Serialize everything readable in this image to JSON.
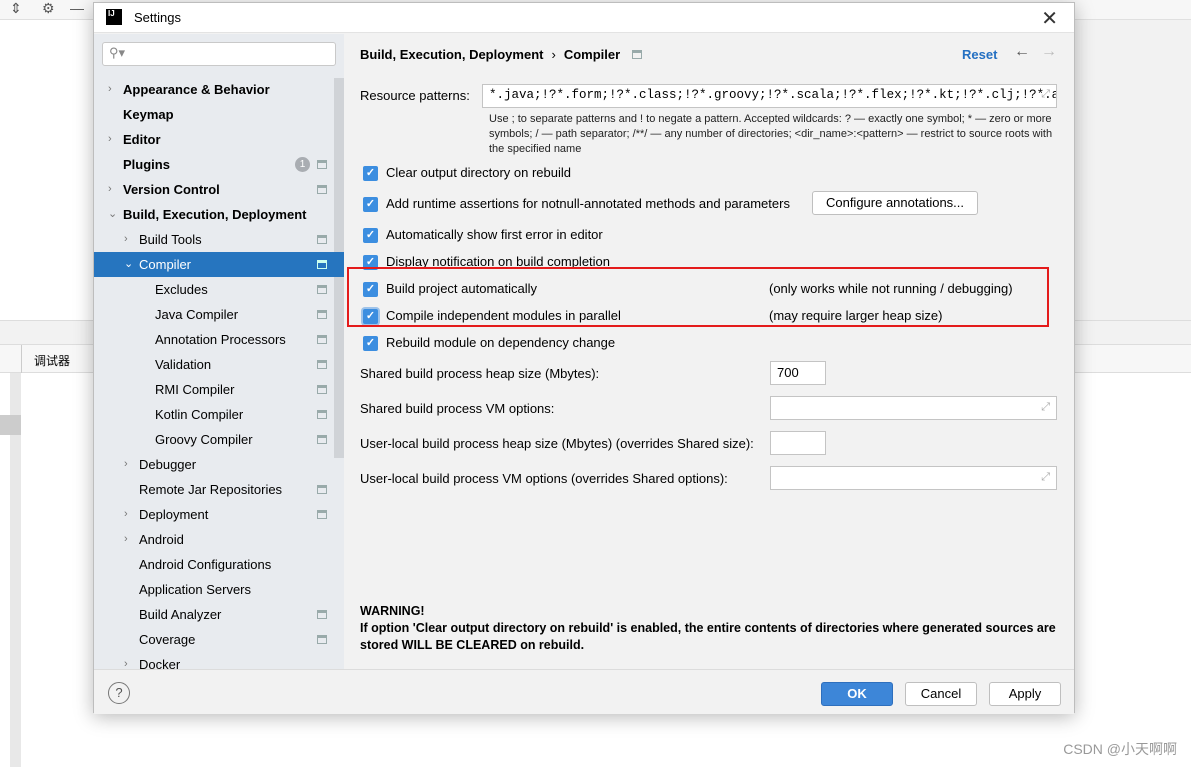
{
  "background": {
    "tab_label": "调试器",
    "watermark": "CSDN @小天啊啊"
  },
  "dialog": {
    "title": "Settings",
    "logo": "IJ",
    "close": "✕"
  },
  "sidebar": {
    "search_placeholder": "",
    "items": [
      {
        "label": "Appearance & Behavior",
        "level": 0,
        "arrow": "›",
        "bold": true
      },
      {
        "label": "Keymap",
        "level": 0,
        "arrow": "",
        "bold": true
      },
      {
        "label": "Editor",
        "level": 0,
        "arrow": "›",
        "bold": true
      },
      {
        "label": "Plugins",
        "level": 0,
        "arrow": "",
        "bold": true,
        "badge": "1",
        "cfg": true
      },
      {
        "label": "Version Control",
        "level": 0,
        "arrow": "›",
        "bold": true,
        "cfg": true
      },
      {
        "label": "Build, Execution, Deployment",
        "level": 0,
        "arrow": "⌄",
        "bold": true
      },
      {
        "label": "Build Tools",
        "level": 1,
        "arrow": "›",
        "cfg": true
      },
      {
        "label": "Compiler",
        "level": 1,
        "arrow": "⌄",
        "cfg": true,
        "selected": true
      },
      {
        "label": "Excludes",
        "level": 2,
        "arrow": "",
        "cfg": true
      },
      {
        "label": "Java Compiler",
        "level": 2,
        "arrow": "",
        "cfg": true
      },
      {
        "label": "Annotation Processors",
        "level": 2,
        "arrow": "",
        "cfg": true
      },
      {
        "label": "Validation",
        "level": 2,
        "arrow": "",
        "cfg": true
      },
      {
        "label": "RMI Compiler",
        "level": 2,
        "arrow": "",
        "cfg": true
      },
      {
        "label": "Kotlin Compiler",
        "level": 2,
        "arrow": "",
        "cfg": true
      },
      {
        "label": "Groovy Compiler",
        "level": 2,
        "arrow": "",
        "cfg": true
      },
      {
        "label": "Debugger",
        "level": 1,
        "arrow": "›"
      },
      {
        "label": "Remote Jar Repositories",
        "level": 1,
        "arrow": "",
        "cfg": true
      },
      {
        "label": "Deployment",
        "level": 1,
        "arrow": "›",
        "cfg": true
      },
      {
        "label": "Android",
        "level": 1,
        "arrow": "›"
      },
      {
        "label": "Android Configurations",
        "level": 1,
        "arrow": ""
      },
      {
        "label": "Application Servers",
        "level": 1,
        "arrow": ""
      },
      {
        "label": "Build Analyzer",
        "level": 1,
        "arrow": "",
        "cfg": true
      },
      {
        "label": "Coverage",
        "level": 1,
        "arrow": "",
        "cfg": true
      },
      {
        "label": "Docker",
        "level": 1,
        "arrow": "›"
      }
    ]
  },
  "main": {
    "breadcrumb": [
      "Build, Execution, Deployment",
      "Compiler"
    ],
    "breadcrumb_sep": "›",
    "reset": "Reset",
    "back": "←",
    "forward": "→",
    "resource_label": "Resource patterns:",
    "resource_value": "*.java;!?*.form;!?*.class;!?*.groovy;!?*.scala;!?*.flex;!?*.kt;!?*.clj;!?*.aj",
    "help_text": "Use ; to separate patterns and ! to negate a pattern. Accepted wildcards: ? — exactly one symbol; * — zero or more symbols; / — path separator; /**/ — any number of directories; <dir_name>:<pattern> — restrict to source roots with the specified name",
    "checkboxes": [
      {
        "label": "Clear output directory on rebuild",
        "checked": true
      },
      {
        "label": "Add runtime assertions for notnull-annotated methods and parameters",
        "checked": true
      },
      {
        "label": "Automatically show first error in editor",
        "checked": true
      },
      {
        "label": "Display notification on build completion",
        "checked": true
      },
      {
        "label": "Build project automatically",
        "checked": true,
        "note": "(only works while not running / debugging)"
      },
      {
        "label": "Compile independent modules in parallel",
        "checked": true,
        "note": "(may require larger heap size)"
      },
      {
        "label": "Rebuild module on dependency change",
        "checked": true
      }
    ],
    "configure_annotations": "Configure annotations...",
    "fields": [
      {
        "label": "Shared build process heap size (Mbytes):",
        "value": "700"
      },
      {
        "label": "Shared build process VM options:",
        "value": ""
      },
      {
        "label": "User-local build process heap size (Mbytes) (overrides Shared size):",
        "value": ""
      },
      {
        "label": "User-local build process VM options (overrides Shared options):",
        "value": ""
      }
    ],
    "warning_title": "WARNING!",
    "warning_text": "If option 'Clear output directory on rebuild' is enabled, the entire contents of directories where generated sources are stored WILL BE CLEARED on rebuild."
  },
  "footer": {
    "help": "?",
    "ok": "OK",
    "cancel": "Cancel",
    "apply": "Apply"
  },
  "colors": {
    "accent": "#2675bf",
    "highlight": "#e41b1b"
  }
}
